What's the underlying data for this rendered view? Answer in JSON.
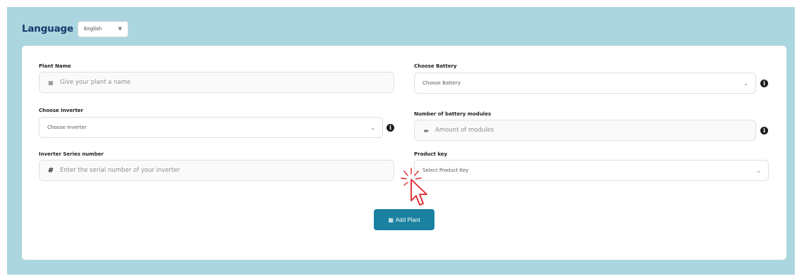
{
  "language": {
    "label": "Language",
    "selected": "English"
  },
  "form": {
    "plant_name": {
      "label": "Plant Name",
      "placeholder": "Give your plant a name",
      "icon": "grid-icon"
    },
    "choose_inverter": {
      "label": "Choose Inverter",
      "selected": "Choose Inverter"
    },
    "inverter_series": {
      "label": "Inverter Series number",
      "placeholder": "Enter the serial number of your inverter",
      "icon": "hash-icon"
    },
    "choose_battery": {
      "label": "Choose Battery",
      "selected": "Choose Battery"
    },
    "battery_modules": {
      "label": "Number of battery modules",
      "placeholder": "Amount of modules",
      "icon": "battery-icon"
    },
    "product_key": {
      "label": "Product key",
      "selected": "Select Product Key"
    },
    "info_glyph": "i",
    "hash_glyph": "#",
    "submit_label": "Add Plant"
  },
  "colors": {
    "background": "#abd6df",
    "title": "#16386b",
    "button": "#1a82a0",
    "cursor": "#e0262b"
  }
}
